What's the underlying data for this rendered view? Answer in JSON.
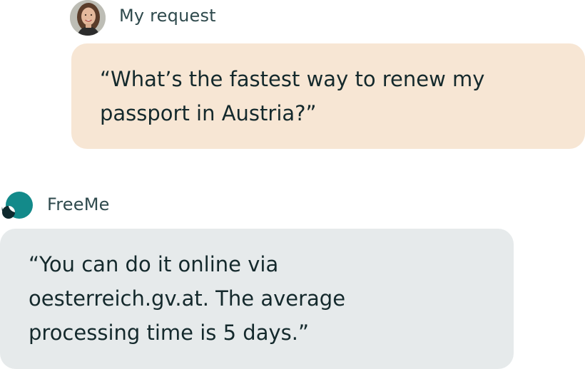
{
  "user": {
    "label": "My request",
    "message_lines": [
      "“What’s the fastest way to renew my",
      "passport in Austria?”"
    ]
  },
  "bot": {
    "label": "FreeMe",
    "message_lines": [
      "“You can do it online via",
      "oesterreich.gv.at. The average",
      "processing time is 5 days.”"
    ]
  },
  "colors": {
    "user_bubble": "#f7e6d4",
    "bot_bubble": "#e6eaeb",
    "logo_teal": "#138a8a",
    "logo_dark": "#0f2a2e",
    "text": "#14292c"
  },
  "icons": {
    "user_avatar": "user-avatar-photo",
    "bot_logo": "freeme-logo-icon"
  }
}
